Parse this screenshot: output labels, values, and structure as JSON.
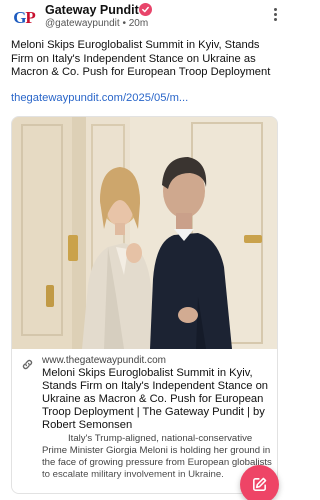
{
  "post": {
    "author": {
      "name": "Gateway Pundit",
      "avatar_text_g": "G",
      "avatar_text_p": "P",
      "handle": "@gatewaypundit",
      "separator": "•",
      "age": "20m",
      "verified": true
    },
    "text": "Meloni Skips Euroglobalist Summit in Kyiv, Stands Firm on Italy's Independent Stance on Ukraine as Macron & Co. Push for European Troop Deployment",
    "link_text": "thegatewaypundit.com/2025/05/m..."
  },
  "link_card": {
    "domain": "www.thegatewaypundit.com",
    "title": "Meloni Skips Euroglobalist Summit in Kyiv, Stands Firm on Italy's Independent Stance on Ukraine as Macron & Co. Push for European Troop Deployment | The Gateway Pundit | by Robert Semonsen",
    "description": "Italy's Trump-aligned, national-conservative Prime Minister Giorgia Meloni is holding her ground in the face of growing pressure from European globalists to escalate military involvement in Ukraine."
  },
  "icons": {
    "more": "more-vertical-icon",
    "verified": "verified-check-icon",
    "link": "link-icon",
    "compose": "compose-icon"
  },
  "colors": {
    "accent": "#ee4466",
    "link": "#2a66c9",
    "verified": "#e8446a"
  }
}
